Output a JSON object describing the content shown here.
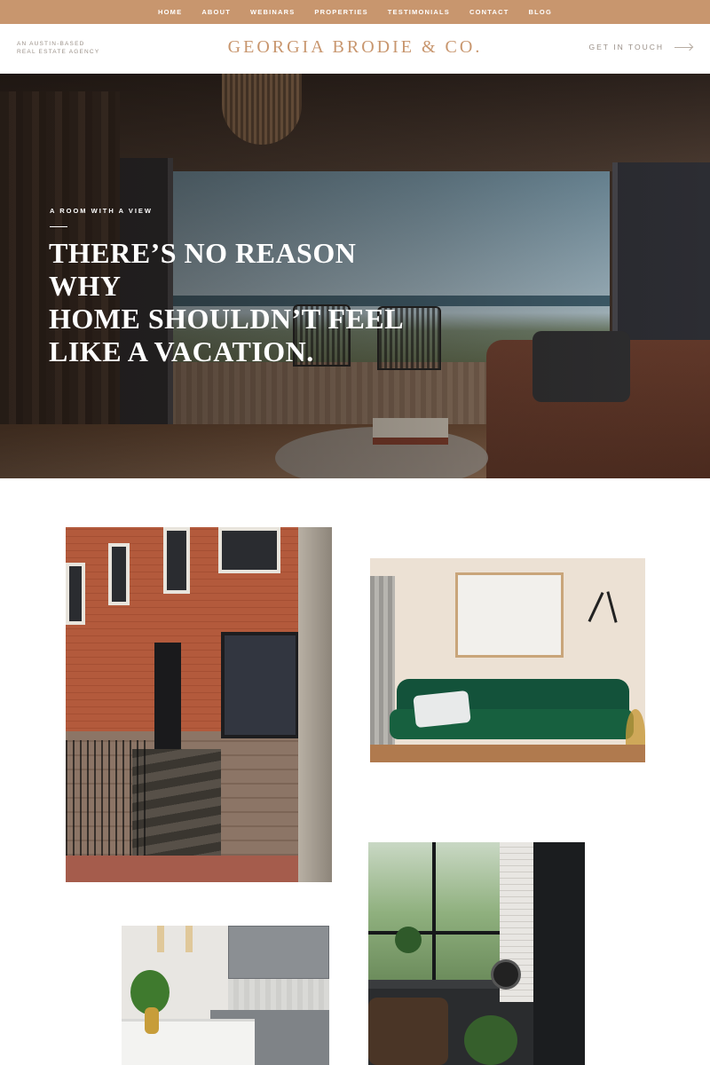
{
  "nav": {
    "items": [
      "HOME",
      "ABOUT",
      "WEBINARS",
      "PROPERTIES",
      "TESTIMONIALS",
      "CONTACT",
      "BLOG"
    ]
  },
  "header": {
    "tagline_line1": "AN AUSTIN-BASED",
    "tagline_line2": "REAL ESTATE AGENCY",
    "brand": "GEORGIA BRODIE & CO.",
    "cta": "GET IN TOUCH"
  },
  "hero": {
    "eyebrow": "A ROOM WITH A VIEW",
    "title_line1": "THERE’S NO REASON WHY",
    "title_line2": "HOME SHOULDN’T FEEL",
    "title_line3": "LIKE A VACATION."
  },
  "colors": {
    "accent": "#c8966e",
    "muted_text": "#9a9088"
  }
}
